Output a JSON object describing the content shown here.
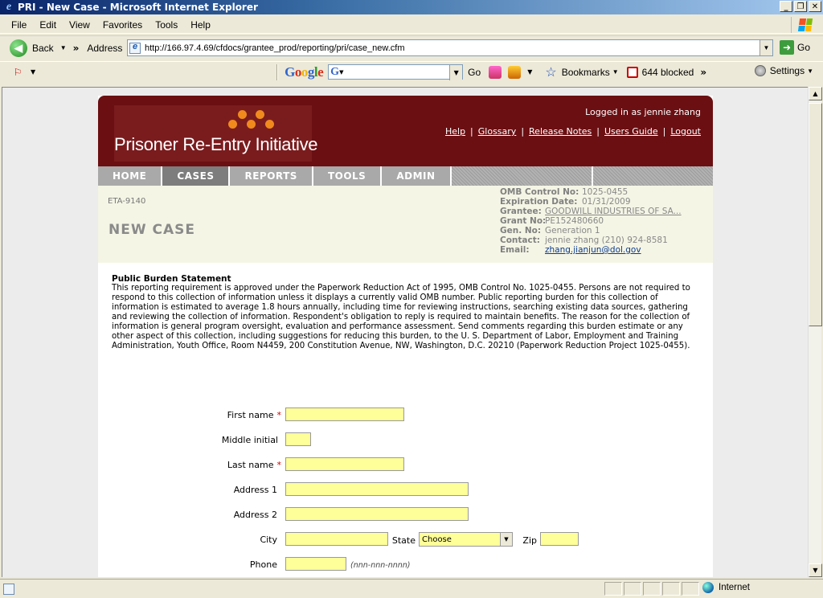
{
  "window": {
    "title": "PRI - New Case - Microsoft Internet Explorer"
  },
  "menu": [
    "File",
    "Edit",
    "View",
    "Favorites",
    "Tools",
    "Help"
  ],
  "address_bar": {
    "back_label": "Back",
    "address_label": "Address",
    "url": "http://166.97.4.69/cfdocs/grantee_prod/reporting/pri/case_new.cfm",
    "go_label": "Go"
  },
  "google_toolbar": {
    "logo": "Google",
    "go_label": "Go",
    "bookmarks_label": "Bookmarks",
    "blocked_label": "644 blocked",
    "settings_label": "Settings"
  },
  "site": {
    "logo_text": "Prisoner Re-Entry Initiative",
    "logged_in": "Logged in as jennie zhang",
    "links": [
      "Help",
      "Glossary",
      "Release Notes",
      "Users Guide",
      "Logout"
    ],
    "nav": [
      "HOME",
      "CASES",
      "REPORTS",
      "TOOLS",
      "ADMIN"
    ],
    "active_nav": "CASES"
  },
  "info": {
    "form_id": "ETA-9140",
    "page_title": "NEW CASE",
    "omb_control_label": "OMB Control No:",
    "omb_control_value": "1025-0455",
    "expiration_label": "Expiration Date:",
    "expiration_value": "01/31/2009",
    "grantee_label": "Grantee:",
    "grantee_value": "GOODWILL INDUSTRIES OF SA...",
    "grant_no_label": "Grant No:",
    "grant_no_value": "PE152480660",
    "gen_no_label": "Gen. No:",
    "gen_no_value": "Generation 1",
    "contact_label": "Contact:",
    "contact_value": "jennie zhang  (210) 924-8581",
    "email_label": "Email:",
    "email_value": "zhang.jianjun@dol.gov"
  },
  "burden": {
    "heading": "Public Burden Statement",
    "text": "This reporting requirement is approved under the Paperwork Reduction Act of 1995, OMB Control No. 1025-0455. Persons are not required to respond to this collection of information unless it displays a currently valid OMB number. Public reporting burden for this collection of information is estimated to average 1.8 hours annually, including time for reviewing instructions, searching existing data sources, gathering and reviewing the collection of information. Respondent's obligation to reply is required to maintain benefits. The reason for the collection of information is general program oversight, evaluation and performance assessment. Send comments regarding this burden estimate or any other aspect of this collection, including suggestions for reducing this burden, to the U. S. Department of Labor, Employment and Training Administration, Youth Office, Room N4459, 200 Constitution Avenue, NW, Washington, D.C. 20210 (Paperwork Reduction Project 1025-0455)."
  },
  "form": {
    "first_name_label": "First name",
    "middle_initial_label": "Middle initial",
    "last_name_label": "Last name",
    "address1_label": "Address 1",
    "address2_label": "Address 2",
    "city_label": "City",
    "state_label": "State",
    "state_value": "Choose",
    "zip_label": "Zip",
    "phone_label": "Phone",
    "phone_hint": "(nnn-nnn-nnnn)",
    "required_mark": "*"
  },
  "status_bar": {
    "zone": "Internet"
  },
  "colors": {
    "banner": "#6b0f12",
    "logo_dots": "#f08a1c",
    "field_bg": "#ffff99",
    "info_bg": "#f5f5e6"
  }
}
